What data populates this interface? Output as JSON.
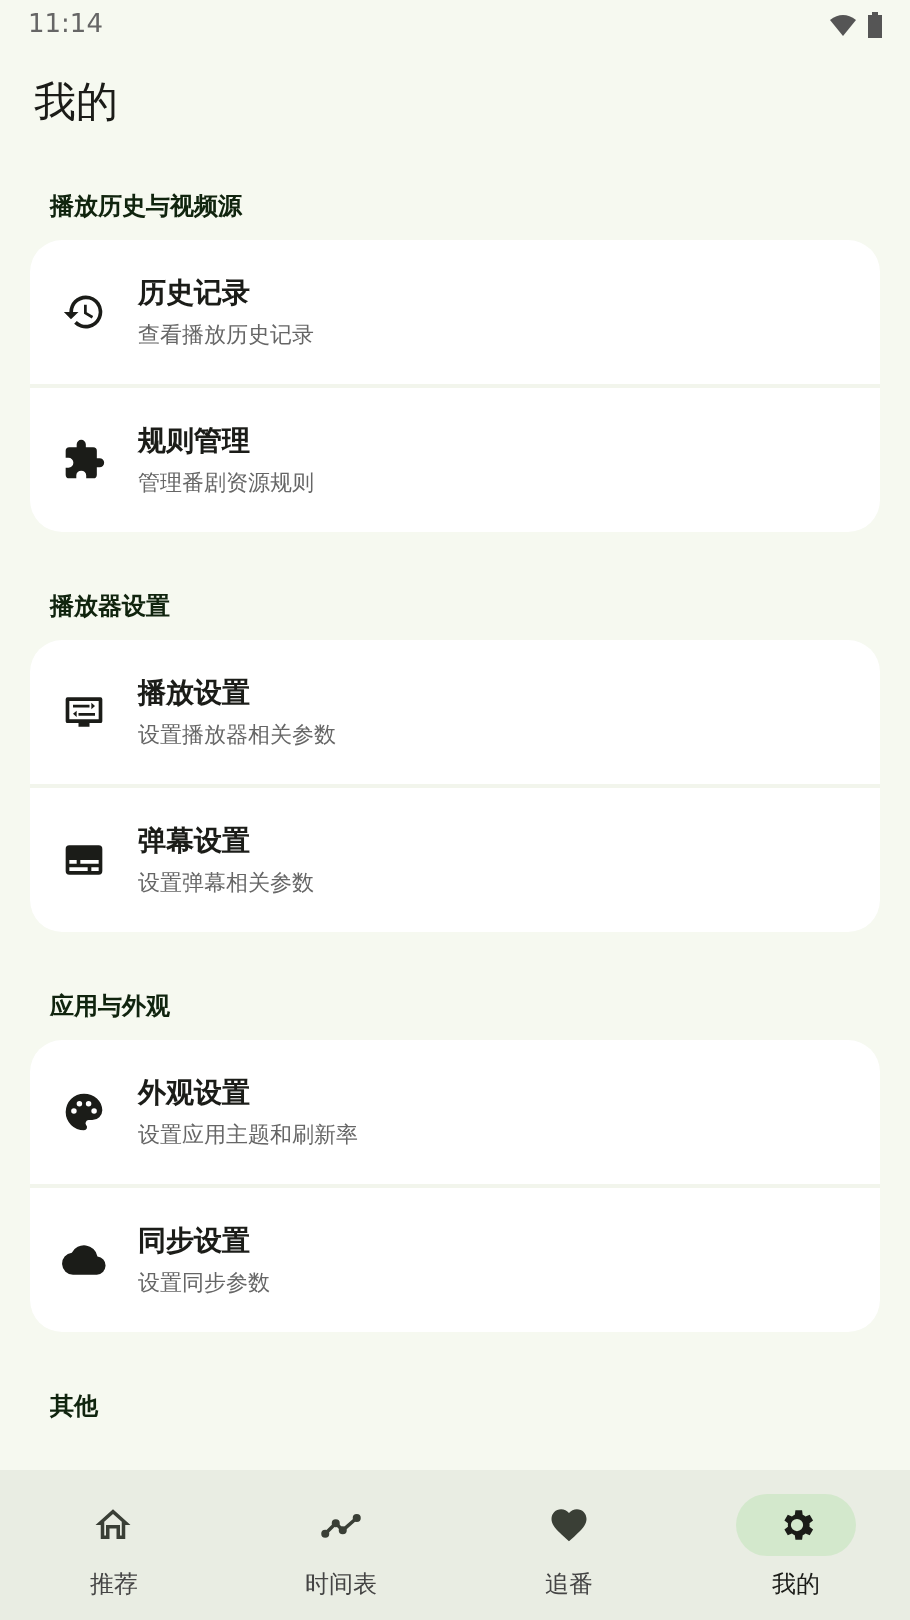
{
  "status_bar": {
    "time": "11:14"
  },
  "title": "我的",
  "sections": [
    {
      "header": "播放历史与视频源",
      "items": [
        {
          "kind": "history",
          "title": "历史记录",
          "subtitle": "查看播放历史记录"
        },
        {
          "kind": "puzzle",
          "title": "规则管理",
          "subtitle": "管理番剧资源规则"
        }
      ]
    },
    {
      "header": "播放器设置",
      "items": [
        {
          "kind": "monitor",
          "title": "播放设置",
          "subtitle": "设置播放器相关参数"
        },
        {
          "kind": "subtitles",
          "title": "弹幕设置",
          "subtitle": "设置弹幕相关参数"
        }
      ]
    },
    {
      "header": "应用与外观",
      "items": [
        {
          "kind": "palette",
          "title": "外观设置",
          "subtitle": "设置应用主题和刷新率"
        },
        {
          "kind": "cloud",
          "title": "同步设置",
          "subtitle": "设置同步参数"
        }
      ]
    },
    {
      "header": "其他"
    }
  ],
  "nav": [
    {
      "kind": "home",
      "label": "推荐",
      "selected": false
    },
    {
      "kind": "trend",
      "label": "时间表",
      "selected": false
    },
    {
      "kind": "heart",
      "label": "追番",
      "selected": false
    },
    {
      "kind": "gear",
      "label": "我的",
      "selected": true
    }
  ]
}
